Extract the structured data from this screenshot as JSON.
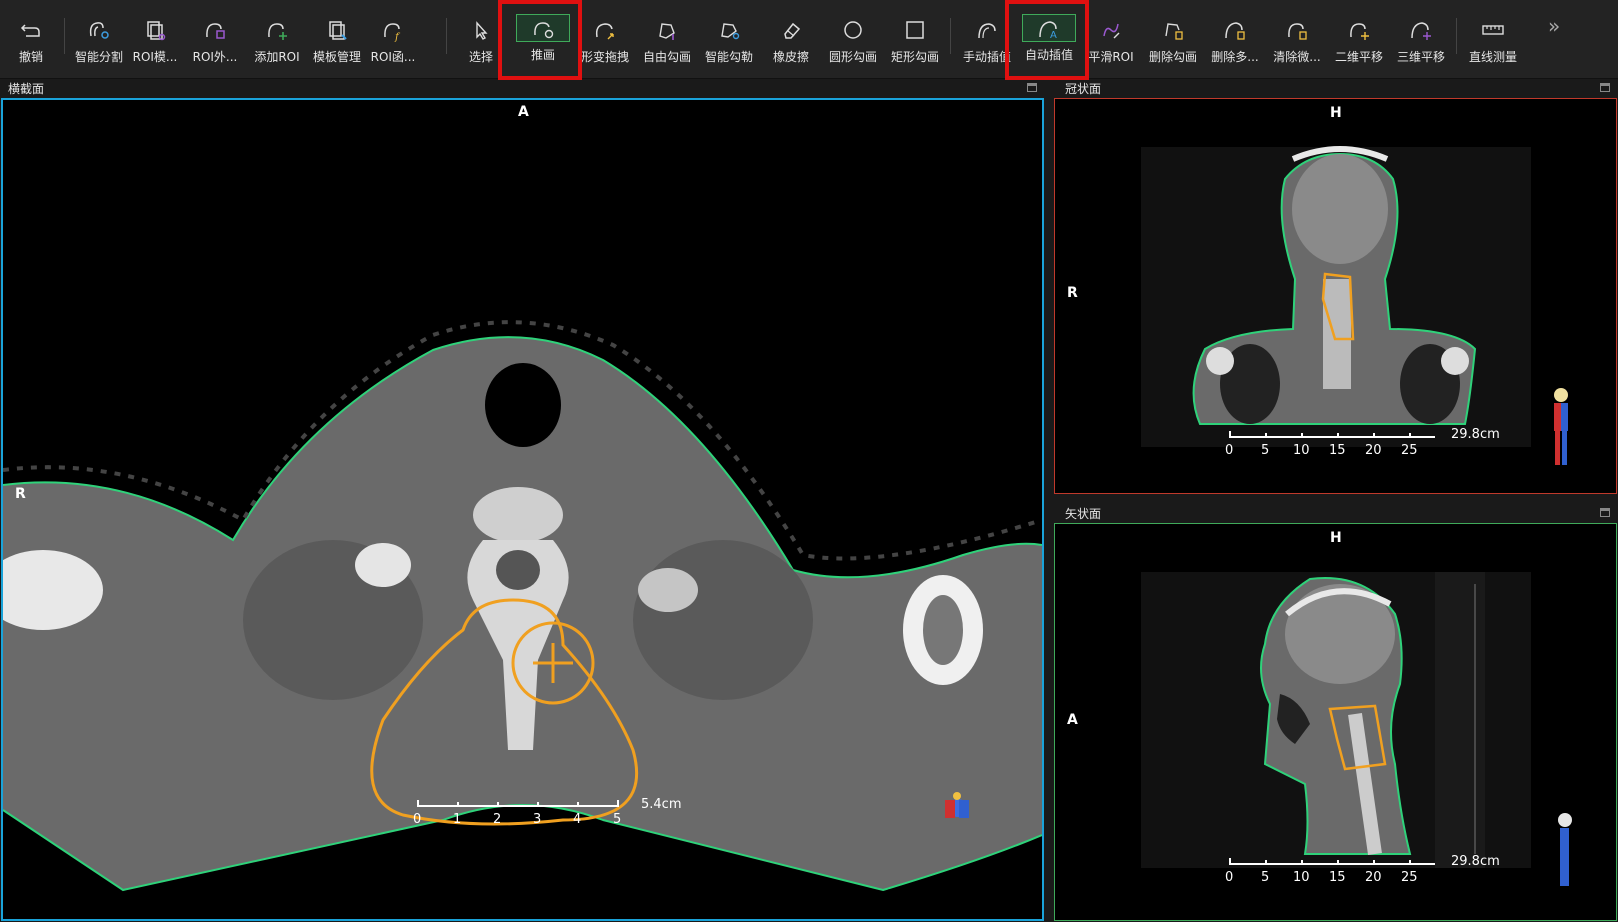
{
  "toolbar": {
    "items": [
      {
        "label": "撤销",
        "icon": "undo-icon"
      },
      {
        "label": "智能分割",
        "icon": "smart-segment-icon"
      },
      {
        "label": "ROI模...",
        "icon": "roi-template-icon"
      },
      {
        "label": "ROI外...",
        "icon": "roi-expand-icon"
      },
      {
        "label": "添加ROI",
        "icon": "add-roi-icon"
      },
      {
        "label": "模板管理",
        "icon": "template-manage-icon"
      },
      {
        "label": "ROI函...",
        "icon": "roi-function-icon"
      },
      {
        "label": "选择",
        "icon": "select-cursor-icon"
      },
      {
        "label": "推画",
        "icon": "push-draw-icon"
      },
      {
        "label": "形变拖拽",
        "icon": "deform-drag-icon"
      },
      {
        "label": "自由勾画",
        "icon": "free-draw-icon"
      },
      {
        "label": "智能勾勒",
        "icon": "smart-contour-icon"
      },
      {
        "label": "橡皮擦",
        "icon": "eraser-icon"
      },
      {
        "label": "圆形勾画",
        "icon": "circle-draw-icon"
      },
      {
        "label": "矩形勾画",
        "icon": "rect-draw-icon"
      },
      {
        "label": "手动插值",
        "icon": "manual-interp-icon"
      },
      {
        "label": "自动插值",
        "icon": "auto-interp-icon"
      },
      {
        "label": "平滑ROI",
        "icon": "smooth-roi-icon"
      },
      {
        "label": "删除勾画",
        "icon": "delete-contour-icon"
      },
      {
        "label": "删除多...",
        "icon": "delete-multi-icon"
      },
      {
        "label": "清除微...",
        "icon": "clear-small-icon"
      },
      {
        "label": "二维平移",
        "icon": "pan-2d-icon"
      },
      {
        "label": "三维平移",
        "icon": "pan-3d-icon"
      },
      {
        "label": "直线测量",
        "icon": "ruler-icon"
      }
    ],
    "more": "»"
  },
  "panels": {
    "axial": {
      "title": "横截面",
      "top": "A",
      "left": "R",
      "scale_ticks": [
        "0",
        "1",
        "2",
        "3",
        "4",
        "5"
      ],
      "scale_value": "5.4cm"
    },
    "coronal": {
      "title": "冠状面",
      "top": "H",
      "left": "R",
      "scale_ticks": [
        "0",
        "5",
        "10",
        "15",
        "20",
        "25"
      ],
      "scale_value": "29.8cm"
    },
    "sagittal": {
      "title": "矢状面",
      "top": "H",
      "left": "A",
      "scale_ticks": [
        "0",
        "5",
        "10",
        "15",
        "20",
        "25"
      ],
      "scale_value": "29.8cm"
    }
  },
  "colors": {
    "accent_active": "#3faa5a",
    "axial_border": "#1aa3d9",
    "coronal_border": "#c0392b",
    "sagittal_border": "#3faa5a",
    "contour_orange": "#f0a020",
    "contour_green": "#2fd27a",
    "highlight_red": "#e01010"
  }
}
